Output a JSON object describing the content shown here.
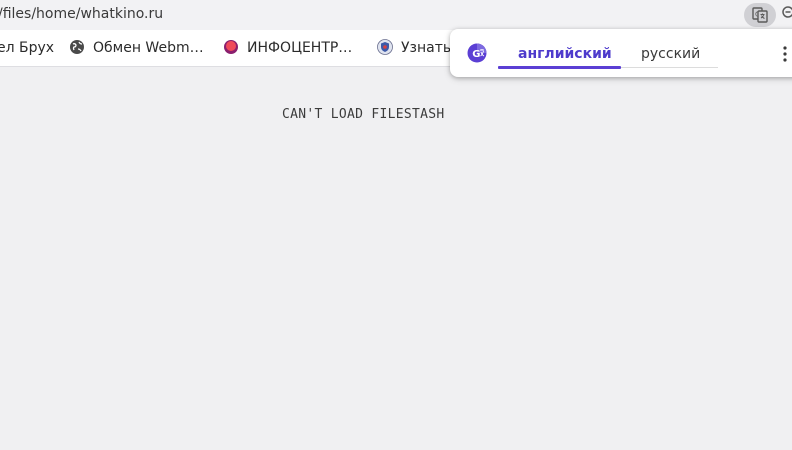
{
  "address_bar": {
    "url": "/files/home/whatkino.ru",
    "icons": [
      "translate-icon",
      "zoom-icon"
    ]
  },
  "bookmarks": [
    {
      "label": "ел Брух",
      "icon": null
    },
    {
      "label": "Обмен Webm…",
      "icon": "globe-icon"
    },
    {
      "label": "ИНФОЦЕНТР…",
      "icon": "red-circle-icon"
    },
    {
      "label": "Узнать",
      "icon": "shield-icon"
    }
  ],
  "content": {
    "message": "CAN'T LOAD FILESTASH"
  },
  "translate_popup": {
    "logo": "google-translate-icon",
    "tabs": [
      {
        "label": "английский",
        "active": true
      },
      {
        "label": "русский",
        "active": false
      }
    ],
    "menu_icon": "kebab-menu-icon"
  },
  "colors": {
    "accent": "#5b3fd4",
    "active_tab_text": "#4e3bcc",
    "page_background": "#f0f0f2",
    "bookmarks_background": "#ffffff"
  }
}
